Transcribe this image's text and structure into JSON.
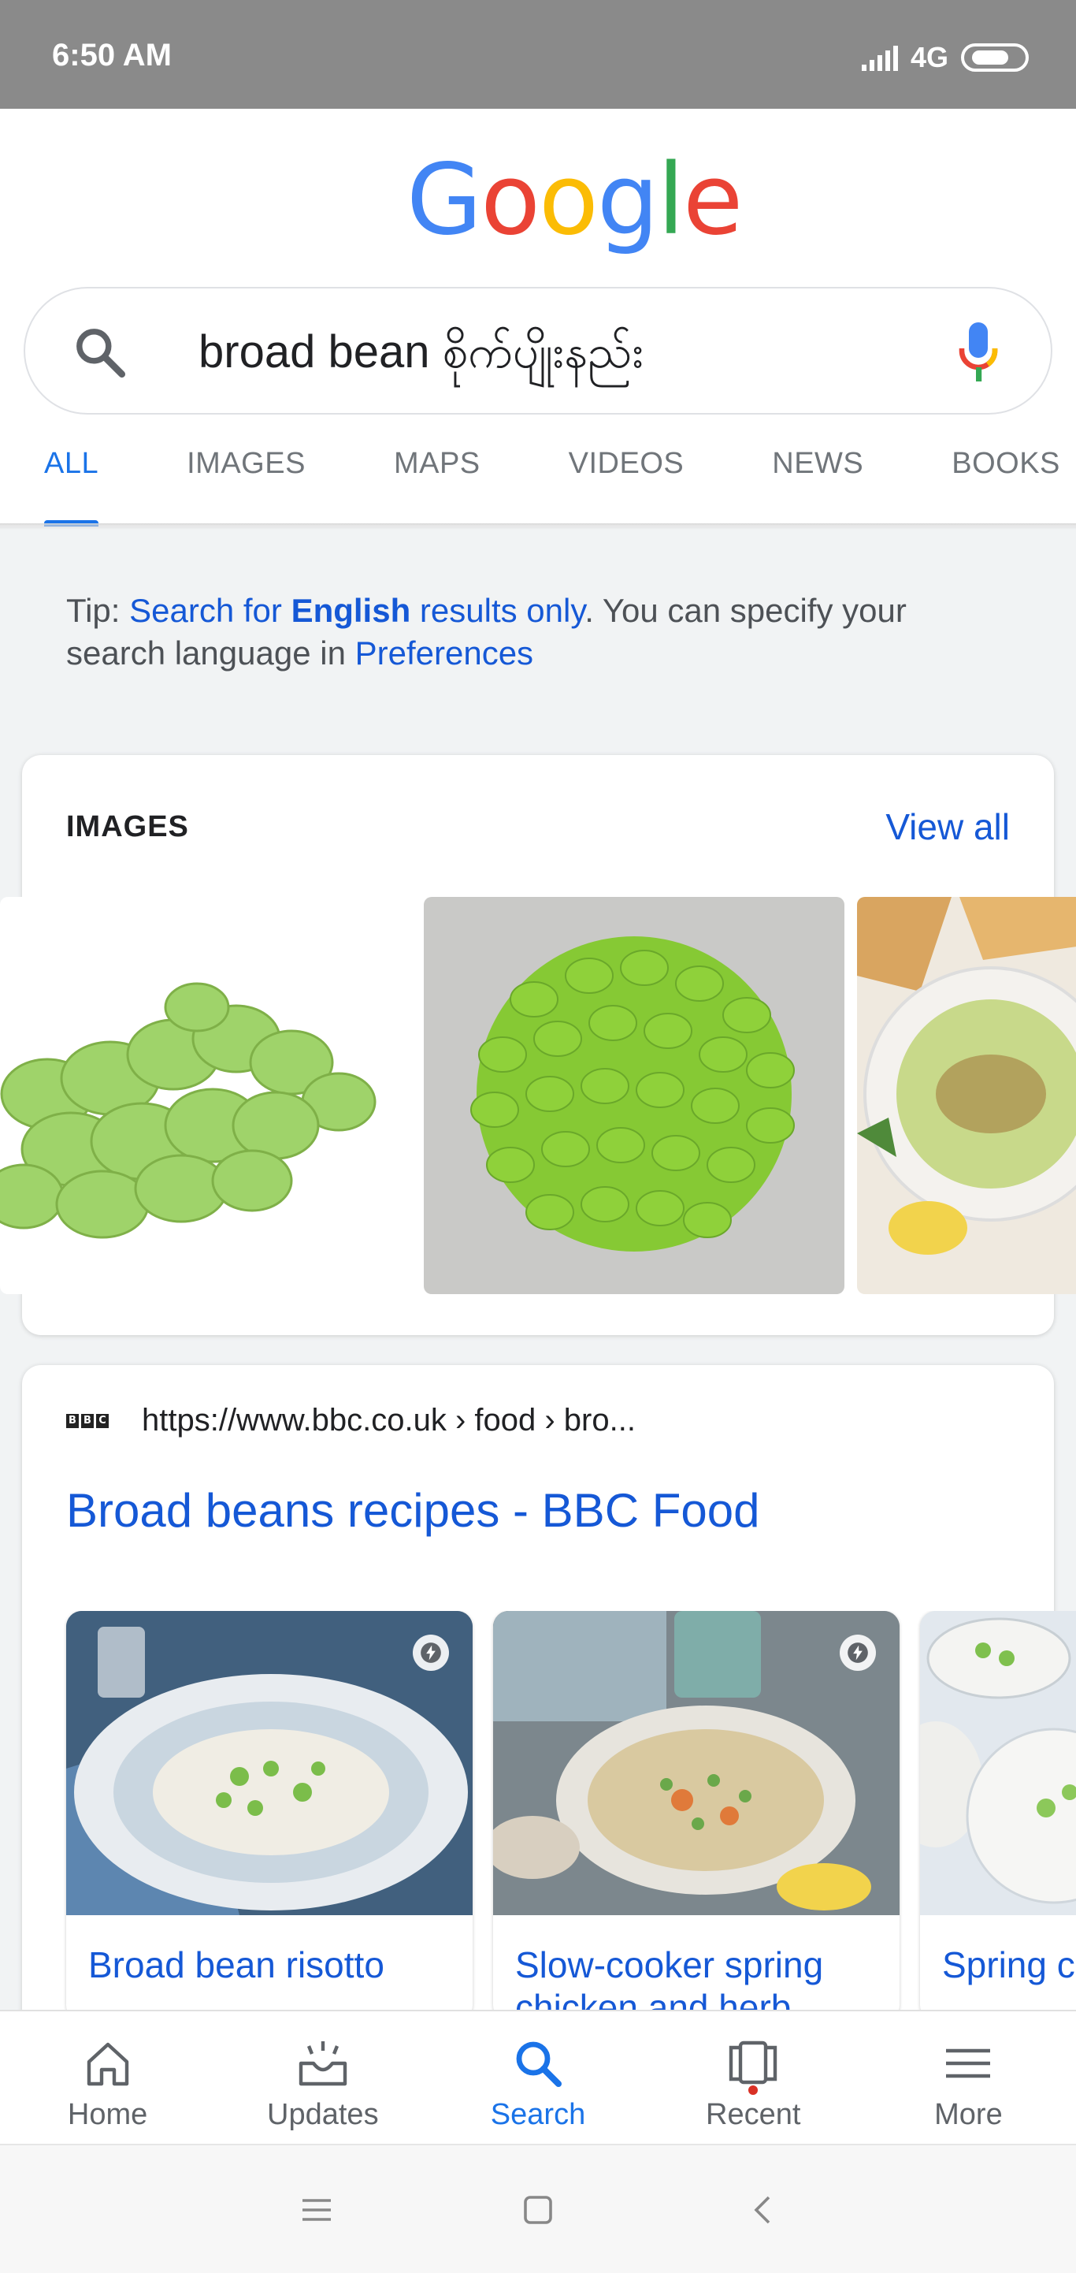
{
  "status_bar": {
    "time": "6:50 AM",
    "network": "4G",
    "network_sub": "ᵢₗ"
  },
  "logo": {
    "letters": [
      "G",
      "o",
      "o",
      "g",
      "l",
      "e"
    ],
    "colors": [
      "#4285f4",
      "#ea4335",
      "#fbbc05",
      "#4285f4",
      "#34a853",
      "#ea4335"
    ]
  },
  "search": {
    "query": "broad bean စိုက်ပျိုးနည်း",
    "icon": "search-icon",
    "mic_icon": "mic-icon"
  },
  "tabs": [
    {
      "label": "ALL",
      "active": true
    },
    {
      "label": "IMAGES",
      "active": false
    },
    {
      "label": "MAPS",
      "active": false
    },
    {
      "label": "VIDEOS",
      "active": false
    },
    {
      "label": "NEWS",
      "active": false
    },
    {
      "label": "BOOKS",
      "active": false
    }
  ],
  "tip": {
    "prefix": "Tip: ",
    "link_start": "Search for ",
    "link_bold": "English",
    "link_end": " results only",
    "middle": ". You can specify your search language in ",
    "pref_link": "Preferences"
  },
  "images_section": {
    "label": "IMAGES",
    "view_all": "View all"
  },
  "result": {
    "logo_letters": [
      "B",
      "B",
      "C"
    ],
    "url": "https://www.bbc.co.uk › food › bro...",
    "title": "Broad beans recipes - BBC Food",
    "recipes": [
      {
        "title": "Broad bean risotto",
        "amp": true
      },
      {
        "title": "Slow-cooker spring chicken and herb",
        "amp": true
      },
      {
        "title": "Spring c",
        "amp": false
      }
    ]
  },
  "bottom_nav": [
    {
      "label": "Home",
      "icon": "home-icon",
      "active": false
    },
    {
      "label": "Updates",
      "icon": "updates-icon",
      "active": false
    },
    {
      "label": "Search",
      "icon": "search-icon",
      "active": true
    },
    {
      "label": "Recent",
      "icon": "recent-icon",
      "active": false
    },
    {
      "label": "More",
      "icon": "menu-icon",
      "active": false
    }
  ],
  "accent_color": "#1a73e8",
  "link_color": "#1558d6"
}
